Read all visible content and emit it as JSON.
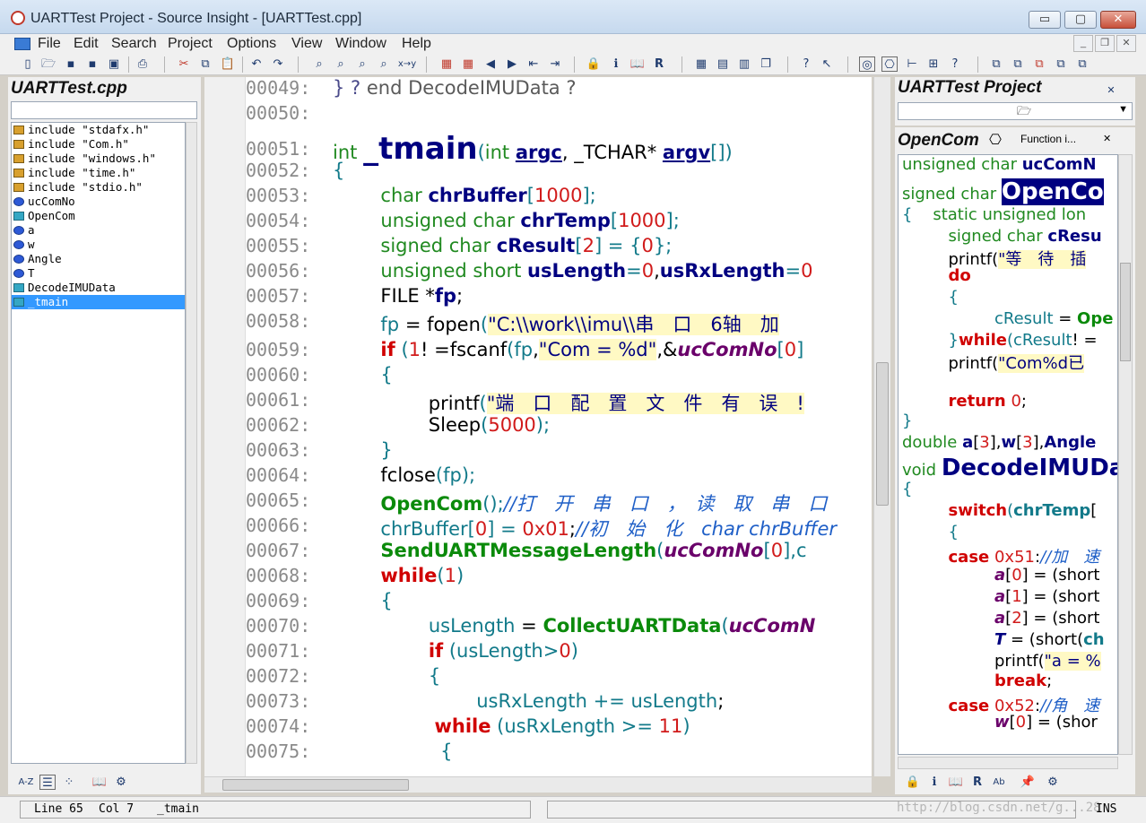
{
  "window": {
    "title": "UARTTest Project - Source Insight - [UARTTest.cpp]",
    "minimize_glyph": "▭",
    "maximize_glyph": "▢",
    "close_glyph": "✕"
  },
  "menu": {
    "items": [
      "File",
      "Edit",
      "Search",
      "Project",
      "Options",
      "View",
      "Window",
      "Help"
    ],
    "mdi_min": "_",
    "mdi_restore": "❐",
    "mdi_close": "✕"
  },
  "left_panel": {
    "title": "UARTTest.cpp",
    "symbols": [
      {
        "label": "include \"stdafx.h\"",
        "kind": "include"
      },
      {
        "label": "include \"Com.h\"",
        "kind": "include"
      },
      {
        "label": "include \"windows.h\"",
        "kind": "include"
      },
      {
        "label": "include \"time.h\"",
        "kind": "include"
      },
      {
        "label": "include \"stdio.h\"",
        "kind": "include"
      },
      {
        "label": "ucComNo",
        "kind": "func"
      },
      {
        "label": "OpenCom",
        "kind": "func"
      },
      {
        "label": "a",
        "kind": "var"
      },
      {
        "label": "w",
        "kind": "var"
      },
      {
        "label": "Angle",
        "kind": "var"
      },
      {
        "label": "T",
        "kind": "var"
      },
      {
        "label": "DecodeIMUData",
        "kind": "func"
      },
      {
        "label": "_tmain",
        "kind": "func",
        "selected": true
      }
    ],
    "sort_label": "A-Z"
  },
  "editor": {
    "lines": [
      {
        "num": "00049:",
        "html": "<span style='color:#4a4a8a'>} ?</span>  <span style='color:#5a5a5a'>end DecodeIMUData ?</span>"
      },
      {
        "num": "00050:",
        "html": ""
      },
      {
        "num": "00051:",
        "html": "<span class='k-type'>int</span> <span class='k-id' style='font-size:34px'>_tmain</span><span class='k-op'>(</span><span class='k-type'>int</span> <span class='k-id' style='text-decoration:underline'>argc</span>, _TCHAR* <span class='k-id' style='text-decoration:underline'>argv</span><span class='k-op'>[])</span>"
      },
      {
        "num": "00052:",
        "html": "<span class='k-op'>{</span>"
      },
      {
        "num": "00053:",
        "html": "&nbsp;&nbsp;&nbsp;&nbsp;&nbsp;&nbsp;&nbsp;&nbsp;<span class='k-type'>char</span> <span class='k-id'>chrBuffer</span><span class='k-op'>[</span><span class='k-num'>1000</span><span class='k-op'>];</span>"
      },
      {
        "num": "00054:",
        "html": "&nbsp;&nbsp;&nbsp;&nbsp;&nbsp;&nbsp;&nbsp;&nbsp;<span class='k-type'>unsigned char</span> <span class='k-id'>chrTemp</span><span class='k-op'>[</span><span class='k-num'>1000</span><span class='k-op'>];</span>"
      },
      {
        "num": "00055:",
        "html": "&nbsp;&nbsp;&nbsp;&nbsp;&nbsp;&nbsp;&nbsp;&nbsp;<span class='k-type'>signed char</span> <span class='k-id'>cResult</span><span class='k-op'>[</span><span class='k-num'>2</span><span class='k-op'>] = {</span><span class='k-num'>0</span><span class='k-op'>};</span>"
      },
      {
        "num": "00056:",
        "html": "&nbsp;&nbsp;&nbsp;&nbsp;&nbsp;&nbsp;&nbsp;&nbsp;<span class='k-type'>unsigned short</span> <span class='k-id'>usLength</span><span class='k-op'>=</span><span class='k-num'>0</span>,<span class='k-id'>usRxLength</span><span class='k-op'>=</span><span class='k-num'>0</span>"
      },
      {
        "num": "00057:",
        "html": "&nbsp;&nbsp;&nbsp;&nbsp;&nbsp;&nbsp;&nbsp;&nbsp;FILE *<span class='k-id'>fp</span>;"
      },
      {
        "num": "00058:",
        "html": "&nbsp;&nbsp;&nbsp;&nbsp;&nbsp;&nbsp;&nbsp;&nbsp;<span class='k-teal'>fp</span> = fopen<span class='k-op'>(</span><span class='k-str'>\"C:\\\\work\\\\imu\\\\串　口　6轴　加</span>"
      },
      {
        "num": "00059:",
        "html": "&nbsp;&nbsp;&nbsp;&nbsp;&nbsp;&nbsp;&nbsp;&nbsp;<span class='k-red'>if</span> <span class='k-op'>(</span><span class='k-num'>1</span>! =fscanf<span class='k-op'>(</span><span class='k-teal'>fp</span>,<span class='k-str'>\"Com = %d\"</span>,&amp;<span class='k-param'>ucComNo</span><span class='k-op'>[</span><span class='k-num'>0</span><span class='k-op'>]</span>"
      },
      {
        "num": "00060:",
        "html": "&nbsp;&nbsp;&nbsp;&nbsp;&nbsp;&nbsp;&nbsp;&nbsp;<span class='k-op'>{</span>"
      },
      {
        "num": "00061:",
        "html": "&nbsp;&nbsp;&nbsp;&nbsp;&nbsp;&nbsp;&nbsp;&nbsp;&nbsp;&nbsp;&nbsp;&nbsp;&nbsp;&nbsp;&nbsp;&nbsp;printf<span class='k-op'>(</span><span class='k-str'>\"端　口　配　置　文　件　有　误　!</span>"
      },
      {
        "num": "00062:",
        "html": "&nbsp;&nbsp;&nbsp;&nbsp;&nbsp;&nbsp;&nbsp;&nbsp;&nbsp;&nbsp;&nbsp;&nbsp;&nbsp;&nbsp;&nbsp;&nbsp;Sleep<span class='k-op'>(</span><span class='k-num'>5000</span><span class='k-op'>);</span>"
      },
      {
        "num": "00063:",
        "html": "&nbsp;&nbsp;&nbsp;&nbsp;&nbsp;&nbsp;&nbsp;&nbsp;<span class='k-op'>}</span>"
      },
      {
        "num": "00064:",
        "html": "&nbsp;&nbsp;&nbsp;&nbsp;&nbsp;&nbsp;&nbsp;&nbsp;fclose<span class='k-op'>(</span><span class='k-teal'>fp</span><span class='k-op'>);</span>"
      },
      {
        "num": "00065:",
        "html": "&nbsp;&nbsp;&nbsp;&nbsp;&nbsp;&nbsp;&nbsp;&nbsp;<span class='k-green'>OpenCom</span><span class='k-op'>();</span><span class='k-cm'>//打　开　串　口　，　读　取　串　口</span>"
      },
      {
        "num": "00066:",
        "html": "&nbsp;&nbsp;&nbsp;&nbsp;&nbsp;&nbsp;&nbsp;&nbsp;<span class='k-teal'>chrBuffer</span><span class='k-op'>[</span><span class='k-num'>0</span><span class='k-op'>] = </span><span class='k-num'>0x01</span>;<span class='k-cm'>//初　始　化　char chrBuffer</span>"
      },
      {
        "num": "00067:",
        "html": "&nbsp;&nbsp;&nbsp;&nbsp;&nbsp;&nbsp;&nbsp;&nbsp;<span class='k-green'>SendUARTMessageLength</span><span class='k-op'>(</span><span class='k-param'>ucComNo</span><span class='k-op'>[</span><span class='k-num'>0</span><span class='k-op'>],</span><span class='k-teal'>c</span>"
      },
      {
        "num": "00068:",
        "html": "&nbsp;&nbsp;&nbsp;&nbsp;&nbsp;&nbsp;&nbsp;&nbsp;<span class='k-red'>while</span><span class='k-op'>(</span><span class='k-num'>1</span><span class='k-op'>)</span>"
      },
      {
        "num": "00069:",
        "html": "&nbsp;&nbsp;&nbsp;&nbsp;&nbsp;&nbsp;&nbsp;&nbsp;<span class='k-op'>{</span>"
      },
      {
        "num": "00070:",
        "html": "&nbsp;&nbsp;&nbsp;&nbsp;&nbsp;&nbsp;&nbsp;&nbsp;&nbsp;&nbsp;&nbsp;&nbsp;&nbsp;&nbsp;&nbsp;&nbsp;<span class='k-teal'>usLength</span> = <span class='k-green'>CollectUARTData</span><span class='k-op'>(</span><span class='k-param'>ucComN</span>"
      },
      {
        "num": "00071:",
        "html": "&nbsp;&nbsp;&nbsp;&nbsp;&nbsp;&nbsp;&nbsp;&nbsp;&nbsp;&nbsp;&nbsp;&nbsp;&nbsp;&nbsp;&nbsp;&nbsp;<span class='k-red'>if</span> <span class='k-op'>(</span><span class='k-teal'>usLength</span><span class='k-op'>&gt;</span><span class='k-num'>0</span><span class='k-op'>)</span>"
      },
      {
        "num": "00072:",
        "html": "&nbsp;&nbsp;&nbsp;&nbsp;&nbsp;&nbsp;&nbsp;&nbsp;&nbsp;&nbsp;&nbsp;&nbsp;&nbsp;&nbsp;&nbsp;&nbsp;<span class='k-op'>{</span>"
      },
      {
        "num": "00073:",
        "html": "&nbsp;&nbsp;&nbsp;&nbsp;&nbsp;&nbsp;&nbsp;&nbsp;&nbsp;&nbsp;&nbsp;&nbsp;&nbsp;&nbsp;&nbsp;&nbsp;&nbsp;&nbsp;&nbsp;&nbsp;&nbsp;&nbsp;&nbsp;&nbsp;<span class='k-teal'>usRxLength</span> <span class='k-op'>+=</span> <span class='k-teal'>usLength</span>;"
      },
      {
        "num": "00074:",
        "html": "&nbsp;&nbsp;&nbsp;&nbsp;&nbsp;&nbsp;&nbsp;&nbsp;&nbsp;&nbsp;&nbsp;&nbsp;&nbsp;&nbsp;&nbsp;&nbsp;&nbsp;<span class='k-red'>while</span> <span class='k-op'>(</span><span class='k-teal'>usRxLength</span> <span class='k-op'>&gt;=</span> <span class='k-num'>11</span><span class='k-op'>)</span>"
      },
      {
        "num": "00075:",
        "html": "&nbsp;&nbsp;&nbsp;&nbsp;&nbsp;&nbsp;&nbsp;&nbsp;&nbsp;&nbsp;&nbsp;&nbsp;&nbsp;&nbsp;&nbsp;&nbsp;&nbsp;&nbsp;<span class='k-op'>{</span>"
      }
    ]
  },
  "right_top": {
    "title": "UARTTest Project",
    "field_icon": "🗁"
  },
  "right_bottom": {
    "title": "OpenCom",
    "function_label": "Function i...",
    "lines": [
      {
        "html": "<span class='k-type'>unsigned char</span> <span class='k-id'>ucComN</span>"
      },
      {
        "html": "<span class='k-type'>signed char</span> <span style='background:#000080;color:#fff;font-weight:bold;font-size:26px'>OpenCo</span>"
      },
      {
        "html": "<span class='k-op'>{</span>&nbsp;&nbsp;&nbsp;&nbsp;<span class='k-type'>static unsigned lon</span>"
      },
      {
        "html": "&nbsp;&nbsp;&nbsp;&nbsp;&nbsp;&nbsp;&nbsp;&nbsp;&nbsp;<span class='k-type'>signed char</span> <span class='k-id'>cResu</span>"
      },
      {
        "html": "&nbsp;&nbsp;&nbsp;&nbsp;&nbsp;&nbsp;&nbsp;&nbsp;&nbsp;printf(<span class='k-str'>\"等　待　插</span>"
      },
      {
        "html": "&nbsp;&nbsp;&nbsp;&nbsp;&nbsp;&nbsp;&nbsp;&nbsp;&nbsp;<span class='k-red'>do</span>"
      },
      {
        "html": "&nbsp;&nbsp;&nbsp;&nbsp;&nbsp;&nbsp;&nbsp;&nbsp;&nbsp;<span class='k-op'>{</span>"
      },
      {
        "html": "&nbsp;&nbsp;&nbsp;&nbsp;&nbsp;&nbsp;&nbsp;&nbsp;&nbsp;&nbsp;&nbsp;&nbsp;&nbsp;&nbsp;&nbsp;&nbsp;&nbsp;&nbsp;<span class='k-teal'>cResult</span> = <span class='k-green'>Ope</span>"
      },
      {
        "html": "&nbsp;&nbsp;&nbsp;&nbsp;&nbsp;&nbsp;&nbsp;&nbsp;&nbsp;<span class='k-op'>}</span><span class='k-red'>while</span><span class='k-op'>(</span><span class='k-teal'>cResult</span>! ="
      },
      {
        "html": "&nbsp;&nbsp;&nbsp;&nbsp;&nbsp;&nbsp;&nbsp;&nbsp;&nbsp;printf(<span class='k-str'>\"Com%d已</span>"
      },
      {
        "html": ""
      },
      {
        "html": "&nbsp;&nbsp;&nbsp;&nbsp;&nbsp;&nbsp;&nbsp;&nbsp;&nbsp;<span class='k-red'>return</span> <span class='k-num'>0</span>;"
      },
      {
        "html": "<span class='k-op'>}</span>"
      },
      {
        "html": "<span class='k-type'>double</span> <span class='k-id'>a</span>[<span class='k-num'>3</span>],<span class='k-id'>w</span>[<span class='k-num'>3</span>],<span class='k-id'>Angle</span>"
      },
      {
        "html": "<span class='k-type'>void</span> <span class='k-id' style='font-size:26px'>DecodeIMUDa</span>"
      },
      {
        "html": "<span class='k-op'>{</span>"
      },
      {
        "html": "&nbsp;&nbsp;&nbsp;&nbsp;&nbsp;&nbsp;&nbsp;&nbsp;&nbsp;<span class='k-red'>switch</span><span class='k-op'>(</span><span class='k-teal' style='font-weight:bold'>chrTemp</span>["
      },
      {
        "html": "&nbsp;&nbsp;&nbsp;&nbsp;&nbsp;&nbsp;&nbsp;&nbsp;&nbsp;<span class='k-op'>{</span>"
      },
      {
        "html": "&nbsp;&nbsp;&nbsp;&nbsp;&nbsp;&nbsp;&nbsp;&nbsp;&nbsp;<span class='k-red'>case</span> <span class='k-num'>0x51</span>:<span class='k-cm'>//加　速</span>"
      },
      {
        "html": "&nbsp;&nbsp;&nbsp;&nbsp;&nbsp;&nbsp;&nbsp;&nbsp;&nbsp;&nbsp;&nbsp;&nbsp;&nbsp;&nbsp;&nbsp;&nbsp;&nbsp;&nbsp;<span class='k-param'>a</span>[<span class='k-num'>0</span>] = (short"
      },
      {
        "html": "&nbsp;&nbsp;&nbsp;&nbsp;&nbsp;&nbsp;&nbsp;&nbsp;&nbsp;&nbsp;&nbsp;&nbsp;&nbsp;&nbsp;&nbsp;&nbsp;&nbsp;&nbsp;<span class='k-param'>a</span>[<span class='k-num'>1</span>] = (short"
      },
      {
        "html": "&nbsp;&nbsp;&nbsp;&nbsp;&nbsp;&nbsp;&nbsp;&nbsp;&nbsp;&nbsp;&nbsp;&nbsp;&nbsp;&nbsp;&nbsp;&nbsp;&nbsp;&nbsp;<span class='k-param'>a</span>[<span class='k-num'>2</span>] = (short"
      },
      {
        "html": "&nbsp;&nbsp;&nbsp;&nbsp;&nbsp;&nbsp;&nbsp;&nbsp;&nbsp;&nbsp;&nbsp;&nbsp;&nbsp;&nbsp;&nbsp;&nbsp;&nbsp;&nbsp;<span class='k-id' style='font-style:italic'>T</span> = (short(<span class='k-teal' style='font-weight:bold'>ch</span>"
      },
      {
        "html": "&nbsp;&nbsp;&nbsp;&nbsp;&nbsp;&nbsp;&nbsp;&nbsp;&nbsp;&nbsp;&nbsp;&nbsp;&nbsp;&nbsp;&nbsp;&nbsp;&nbsp;&nbsp;printf(<span class='k-str'>\"a = %</span>"
      },
      {
        "html": "&nbsp;&nbsp;&nbsp;&nbsp;&nbsp;&nbsp;&nbsp;&nbsp;&nbsp;&nbsp;&nbsp;&nbsp;&nbsp;&nbsp;&nbsp;&nbsp;&nbsp;&nbsp;<span class='k-red'>break</span>;"
      },
      {
        "html": "&nbsp;&nbsp;&nbsp;&nbsp;&nbsp;&nbsp;&nbsp;&nbsp;&nbsp;<span class='k-red'>case</span> <span class='k-num'>0x52</span>:<span class='k-cm'>//角　速</span>"
      },
      {
        "html": "&nbsp;&nbsp;&nbsp;&nbsp;&nbsp;&nbsp;&nbsp;&nbsp;&nbsp;&nbsp;&nbsp;&nbsp;&nbsp;&nbsp;&nbsp;&nbsp;&nbsp;&nbsp;<span class='k-param'>w</span>[<span class='k-num'>0</span>] = (shor"
      }
    ]
  },
  "status": {
    "line": "Line 65",
    "col": "Col 7",
    "func": "_tmain",
    "mode": "INS",
    "watermark": "http://blog.csdn.net/g...28"
  },
  "colors": {
    "selection": "#3399ff",
    "keyword": "#d00000",
    "type": "#218a21",
    "identifier": "#000080"
  }
}
